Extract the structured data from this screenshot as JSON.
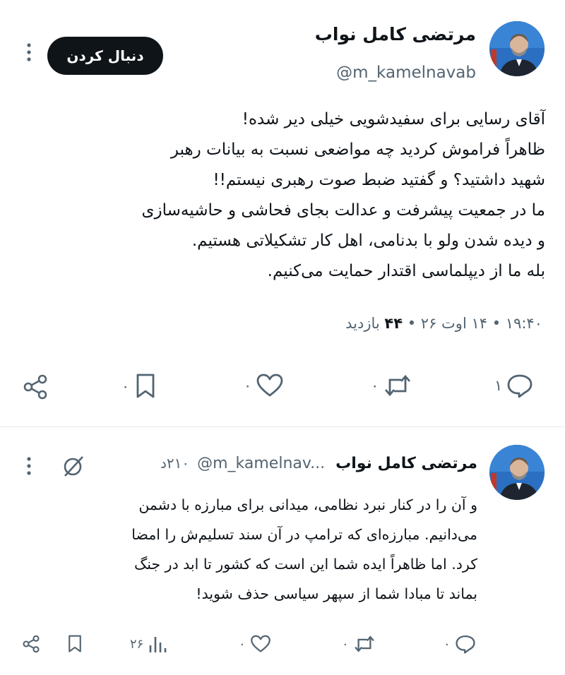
{
  "tweet": {
    "author_name": "مرتضی کامل نواب",
    "author_handle": "@m_kamelnavab",
    "follow_label": "دنبال کردن",
    "text": "آقای رسایی برای سفیدشویی خیلی دیر شده!\nظاهراً فراموش کردید چه مواضعی نسبت به بیانات رهبر\nشهید داشتید؟ و گفتید ضبط صوت رهبری نیستم!!\nما در جمعیت پیشرفت و عدالت بجای فحاشی و حاشیه‌سازی\nو دیده شدن ولو با بدنامی، اهل کار تشکیلاتی هستیم.\nبله ما از دیپلماسی اقتدار حمایت می‌کنیم.",
    "time": "۱۹:۴۰",
    "date": "۱۴ اوت ۲۶",
    "views_count": "۴۴",
    "views_label": "بازدید",
    "dot": "•",
    "actions": {
      "reply": "۱",
      "retweet": "۰",
      "like": "۰",
      "bookmark": "۰"
    }
  },
  "reply": {
    "author_name": "مرتضی کامل نواب",
    "author_handle": "@m_kamelnav...",
    "time_ago": "۲۱۰د",
    "text": "و آن را در کنار نبرد نظامی، میدانی برای مبارزه با دشمن\nمی‌دانیم. مبارزه‌ای که ترامپ در آن سند تسلیم‌ش را امضا\nکرد. اما ظاهراً ایده شما این است که کشور تا ابد در جنگ\nبماند تا مبادا شما از سپهر سیاسی حذف شوید!",
    "actions": {
      "reply": "۰",
      "retweet": "۰",
      "like": "۰",
      "views": "۲۶"
    }
  },
  "icons": [
    "avatar-portrait",
    "more-vertical-icon",
    "reply-icon",
    "retweet-icon",
    "like-icon",
    "bookmark-icon",
    "share-icon",
    "grok-icon",
    "views-icon"
  ],
  "colors": {
    "text": "#0f1419",
    "secondary": "#536471",
    "follow_bg": "#0f1419",
    "avatar_bg": "#2b6fc2"
  }
}
